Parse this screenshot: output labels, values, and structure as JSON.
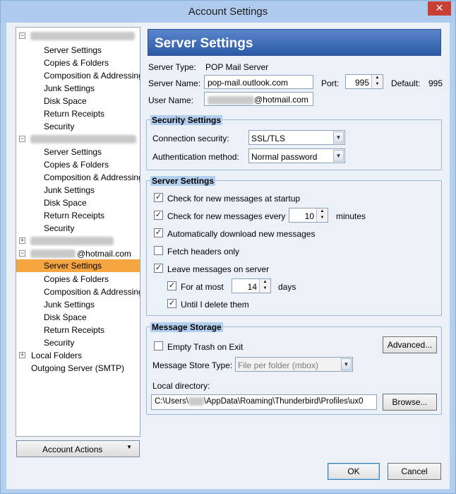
{
  "window": {
    "title": "Account Settings"
  },
  "tree": {
    "accounts": [
      {
        "expanded": true,
        "items": [
          "Server Settings",
          "Copies & Folders",
          "Composition & Addressing",
          "Junk Settings",
          "Disk Space",
          "Return Receipts",
          "Security"
        ]
      },
      {
        "expanded": true,
        "items": [
          "Server Settings",
          "Copies & Folders",
          "Composition & Addressing",
          "Junk Settings",
          "Disk Space",
          "Return Receipts",
          "Security"
        ]
      },
      {
        "expanded": false
      },
      {
        "expanded": true,
        "name_suffix": "@hotmail.com",
        "items": [
          "Server Settings",
          "Copies & Folders",
          "Composition & Addressing",
          "Junk Settings",
          "Disk Space",
          "Return Receipts",
          "Security"
        ],
        "selected_index": 0
      }
    ],
    "local_folders": "Local Folders",
    "outgoing_server": "Outgoing Server (SMTP)",
    "account_actions": "Account Actions"
  },
  "panel": {
    "title": "Server Settings",
    "server_type_label": "Server Type:",
    "server_type_value": "POP Mail Server",
    "server_name_label": "Server Name:",
    "server_name_value": "pop-mail.outlook.com",
    "port_label": "Port:",
    "port_value": "995",
    "default_label": "Default:",
    "default_value": "995",
    "user_name_label": "User Name:",
    "user_name_suffix": "@hotmail.com"
  },
  "security": {
    "title": "Security Settings",
    "connection_label": "Connection security:",
    "connection_value": "SSL/TLS",
    "auth_label": "Authentication method:",
    "auth_value": "Normal password"
  },
  "server_settings": {
    "title": "Server Settings",
    "check_startup": "Check for new messages at startup",
    "check_every": "Check for new messages every",
    "check_every_value": "10",
    "check_every_unit": "minutes",
    "auto_download": "Automatically download new messages",
    "fetch_headers": "Fetch headers only",
    "leave_messages": "Leave messages on server",
    "for_at_most": "For at most",
    "for_at_most_value": "14",
    "for_at_most_unit": "days",
    "until_delete": "Until I delete them"
  },
  "storage": {
    "title": "Message Storage",
    "empty_trash": "Empty Trash on Exit",
    "advanced": "Advanced...",
    "store_type_label": "Message Store Type:",
    "store_type_value": "File per folder (mbox)",
    "local_dir_label": "Local directory:",
    "local_dir_prefix": "C:\\Users\\",
    "local_dir_suffix": "\\AppData\\Roaming\\Thunderbird\\Profiles\\ux0",
    "browse": "Browse..."
  },
  "buttons": {
    "ok": "OK",
    "cancel": "Cancel"
  }
}
